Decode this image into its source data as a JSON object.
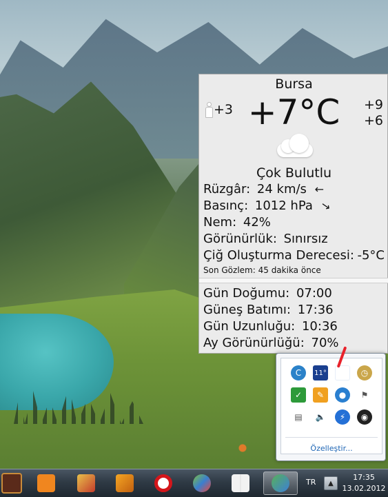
{
  "weather": {
    "city": "Bursa",
    "feels_like": "+3",
    "temperature": "+7°C",
    "high": "+9",
    "low": "+6",
    "condition_icon": "cloud-icon",
    "condition": "Çok Bulutlu",
    "wind_label": "Rüzgâr:",
    "wind_value": "24 km/s",
    "wind_arrow": "←",
    "pressure_label": "Basınç:",
    "pressure_value": "1012 hPa",
    "pressure_arrow": "→",
    "humidity_label": "Nem:",
    "humidity_value": "42%",
    "visibility_label": "Görünürlük:",
    "visibility_value": "Sınırsız",
    "dewpoint_label": "Çiğ Oluşturma Derecesi:",
    "dewpoint_value": "-5°C",
    "observation_label": "Son Gözlem:",
    "observation_value": "45 dakika önce",
    "sunrise_label": "Gün Doğumu:",
    "sunrise_value": "07:00",
    "sunset_label": "Güneş Batımı:",
    "sunset_value": "17:36",
    "daylength_label": "Gün Uzunluğu:",
    "daylength_value": "10:36",
    "moon_label": "Ay Görünürlüğü:",
    "moon_value": "70%"
  },
  "tray": {
    "weather_badge": "11°",
    "customize_link": "Özelleştir..."
  },
  "taskbar": {
    "language": "TR",
    "show_hidden": "▲",
    "time": "17:35",
    "date": "13.02.2012"
  },
  "colors": {
    "flyout_bg": "#ebebeb",
    "taskbar": "#2f3a45",
    "link": "#1c64b4",
    "annotation": "#e8222b"
  }
}
